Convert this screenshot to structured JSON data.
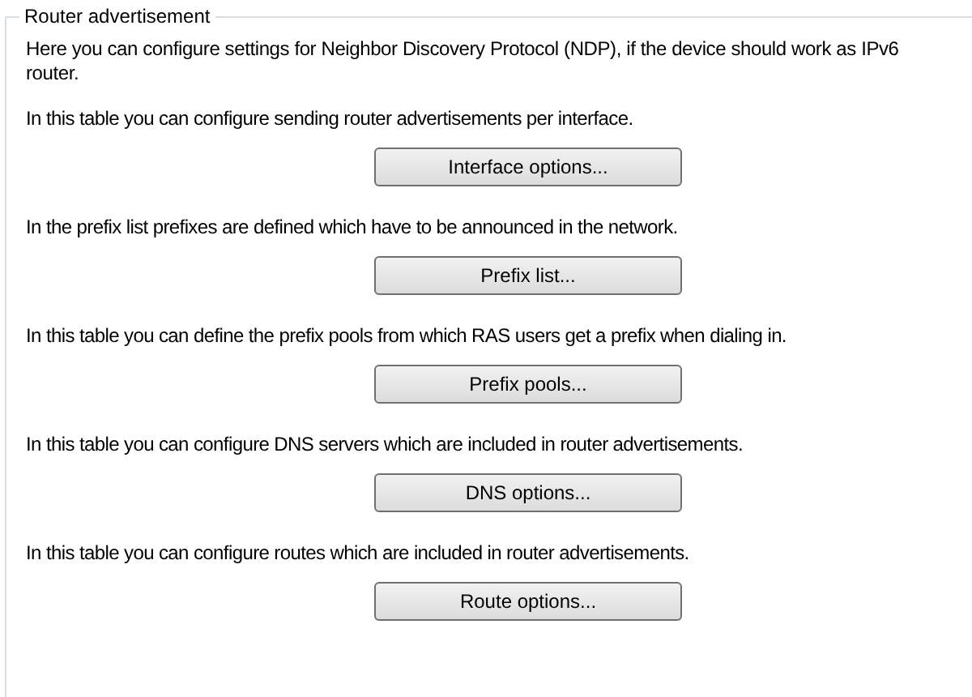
{
  "group": {
    "title": "Router advertisement"
  },
  "intro": "Here you can configure settings for Neighbor Discovery Protocol (NDP), if the device should work as IPv6 router.",
  "sections": [
    {
      "description": "In this table you can configure sending router advertisements per interface.",
      "button": "Interface options..."
    },
    {
      "description": "In the prefix list prefixes are defined which have to be announced in the network.",
      "button": "Prefix list..."
    },
    {
      "description": "In this table you can define the prefix pools from which RAS users get a prefix when dialing in.",
      "button": "Prefix pools..."
    },
    {
      "description": "In this table you can configure DNS servers which are included in router advertisements.",
      "button": "DNS options..."
    },
    {
      "description": "In this table you can configure routes which are included in router advertisements.",
      "button": "Route options..."
    }
  ]
}
